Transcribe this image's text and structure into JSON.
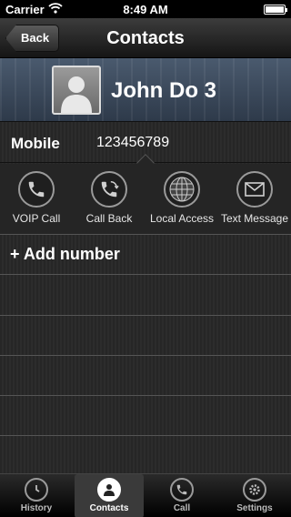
{
  "status_bar": {
    "carrier": "Carrier",
    "time": "8:49 AM"
  },
  "nav": {
    "back_label": "Back",
    "title": "Contacts"
  },
  "contact": {
    "name": "John Do 3",
    "phone_label": "Mobile",
    "phone_value": "123456789"
  },
  "actions": [
    {
      "label": "VOIP Call",
      "icon": "phone-icon"
    },
    {
      "label": "Call Back",
      "icon": "callback-icon"
    },
    {
      "label": "Local Access",
      "icon": "globe-icon"
    },
    {
      "label": "Text Message",
      "icon": "envelope-icon"
    }
  ],
  "add_number_label": "+ Add number",
  "tabs": [
    {
      "label": "History",
      "icon": "clock-icon",
      "active": false
    },
    {
      "label": "Contacts",
      "icon": "person-icon",
      "active": true
    },
    {
      "label": "Call",
      "icon": "phone-icon",
      "active": false
    },
    {
      "label": "Settings",
      "icon": "gear-icon",
      "active": false
    }
  ]
}
